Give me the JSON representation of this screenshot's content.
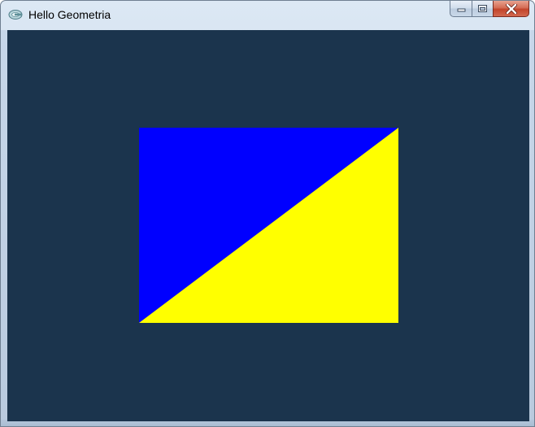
{
  "window": {
    "title": "Hello Geometria"
  },
  "icons": {
    "app": "app-icon",
    "minimize": "minimize-icon",
    "maximize": "maximize-icon",
    "close": "close-icon"
  },
  "colors": {
    "clear_color": "#1b344d",
    "triangle_upper": "#0000ff",
    "triangle_lower": "#ffff00"
  }
}
